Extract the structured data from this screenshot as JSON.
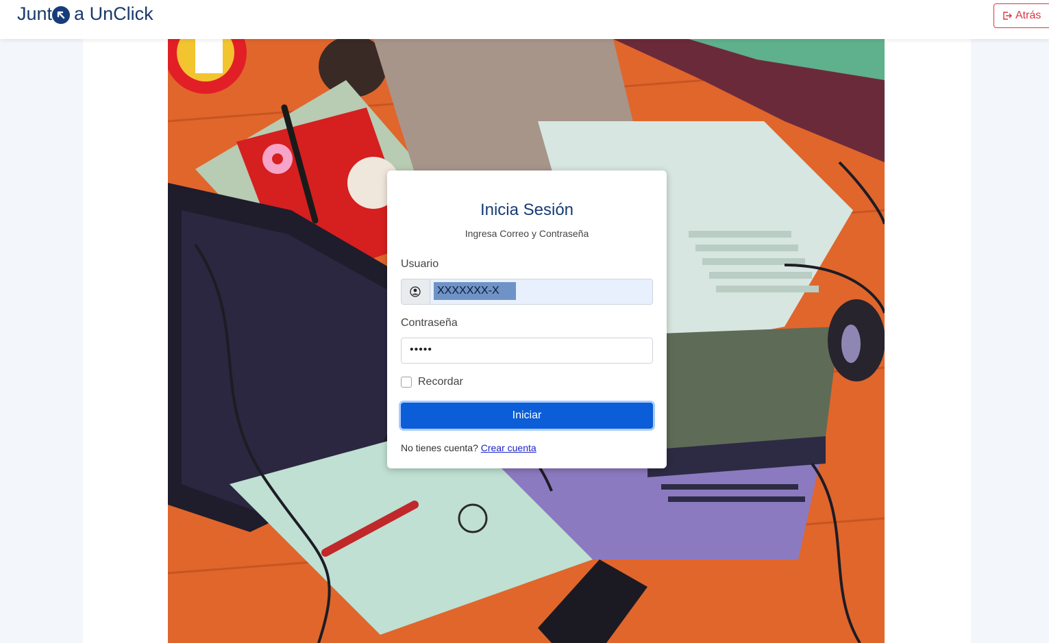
{
  "navbar": {
    "brand_before": "Junt",
    "brand_after": "a UnClick",
    "back_label": "Atrás"
  },
  "hero": {
    "image_icon": "illustration-desk-laptops"
  },
  "login": {
    "title": "Inicia Sesión",
    "subtitle": "Ingresa Correo y Contraseña",
    "username_label": "Usuario",
    "username_value": "XXXXXXX-X",
    "username_icon": "user-circle-icon",
    "password_label": "Contraseña",
    "password_value": "•••••",
    "remember_label": "Recordar",
    "remember_checked": false,
    "submit_label": "Iniciar",
    "no_account_text": "No tienes cuenta?",
    "create_account_link": "Crear cuenta"
  },
  "colors": {
    "brand": "#163d79",
    "primary": "#0b5ed7",
    "danger": "#dc3545",
    "link": "#1a22c9"
  }
}
